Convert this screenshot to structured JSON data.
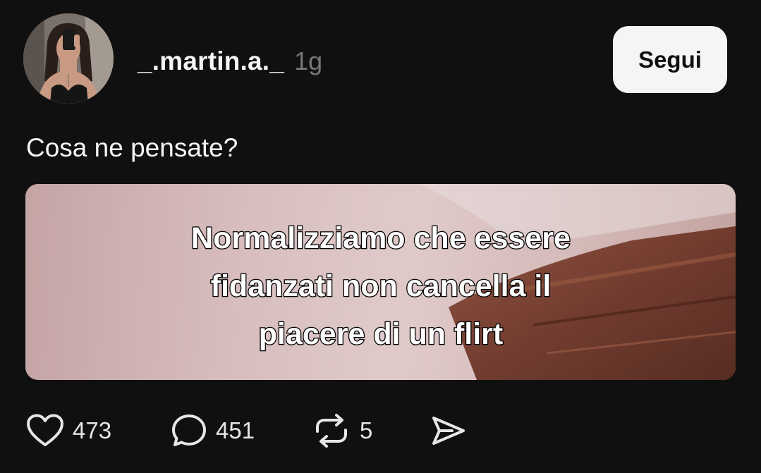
{
  "post": {
    "username": "_.martin.a._",
    "timestamp": "1g",
    "follow_label": "Segui",
    "caption": "Cosa ne pensate?",
    "media": {
      "overlay_lines": [
        "Normalizziamo che essere",
        "fidanzati non cancella il",
        "piacere di un flirt"
      ]
    },
    "actions": {
      "likes": "473",
      "comments": "451",
      "reposts": "5"
    }
  },
  "icons": {
    "like": "heart-icon",
    "comment": "comment-bubble-icon",
    "repost": "repost-icon",
    "share": "send-icon"
  },
  "colors": {
    "background": "#101010",
    "text": "#f3f5f7",
    "muted": "#777777",
    "follow_button_bg": "#f3f5f7",
    "follow_button_text": "#101010"
  }
}
